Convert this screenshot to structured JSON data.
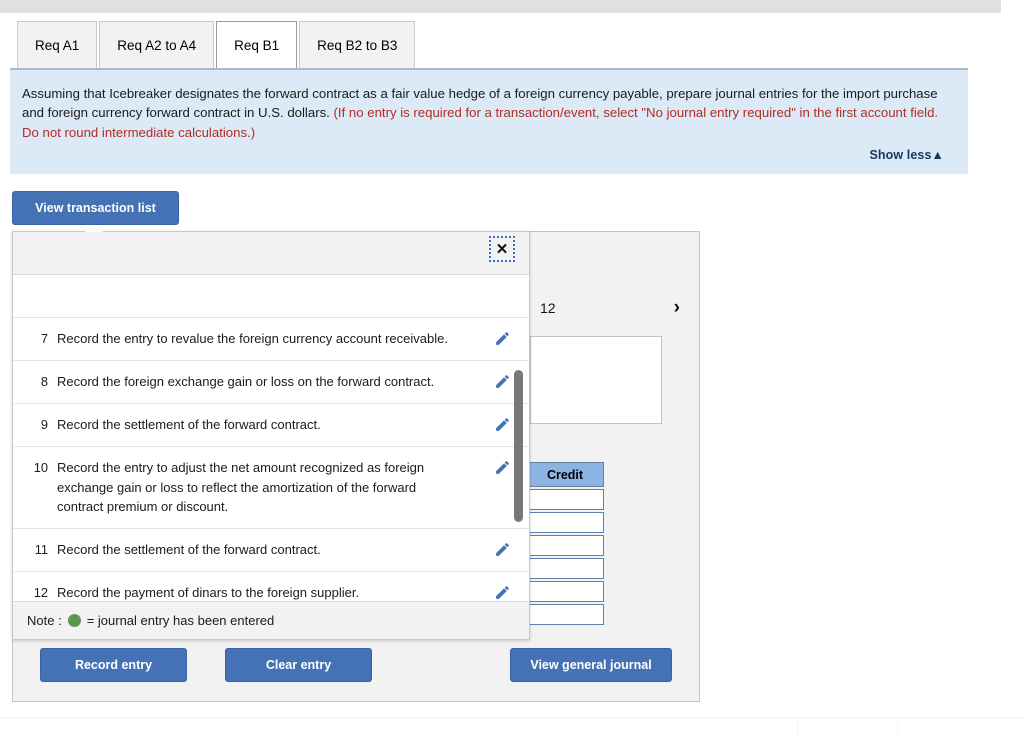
{
  "tabs": [
    {
      "label": "Req A1",
      "active": false
    },
    {
      "label": "Req A2 to A4",
      "active": false
    },
    {
      "label": "Req B1",
      "active": true
    },
    {
      "label": "Req B2 to B3",
      "active": false
    }
  ],
  "instructions": {
    "black_part": "Assuming that Icebreaker designates the forward contract as a fair value hedge of a foreign currency payable, prepare journal entries for the import purchase and foreign currency forward contract in U.S. dollars. ",
    "red_part": "(If no entry is required for a transaction/event, select \"No journal entry required\" in the first account field. Do not round intermediate calculations.)",
    "show_less_label": "Show less▲"
  },
  "toolbar": {
    "view_transaction_list_label": "View transaction list"
  },
  "journal_form": {
    "transaction_number": "12",
    "next_arrow": "›",
    "credit_header": "Credit",
    "credit_rows": [
      "",
      "",
      "",
      "",
      "",
      ""
    ]
  },
  "transaction_popup": {
    "close_label": "✕",
    "items": [
      {
        "num": "7",
        "desc": "Record the entry to revalue the foreign currency account receivable."
      },
      {
        "num": "8",
        "desc": "Record the foreign exchange gain or loss on the forward contract."
      },
      {
        "num": "9",
        "desc": "Record the settlement of the forward contract."
      },
      {
        "num": "10",
        "desc": "Record the entry to adjust the net amount recognized as foreign exchange gain or loss to reflect the amortization of the forward contract premium or discount."
      },
      {
        "num": "11",
        "desc": "Record the settlement of the forward contract."
      },
      {
        "num": "12",
        "desc": "Record the payment of dinars to the foreign supplier."
      }
    ],
    "note_prefix": "Note :",
    "note_suffix": "= journal entry has been entered"
  },
  "actions": {
    "record_entry_label": "Record entry",
    "clear_entry_label": "Clear entry",
    "view_general_journal_label": "View general journal"
  },
  "colors": {
    "button_blue": "#4472b4",
    "panel_blue": "#dce9f7",
    "credit_header_blue": "#8db4e2",
    "instruction_red": "#b32d23",
    "show_less_navy": "#17375e",
    "note_dot_green": "#5f9751"
  }
}
